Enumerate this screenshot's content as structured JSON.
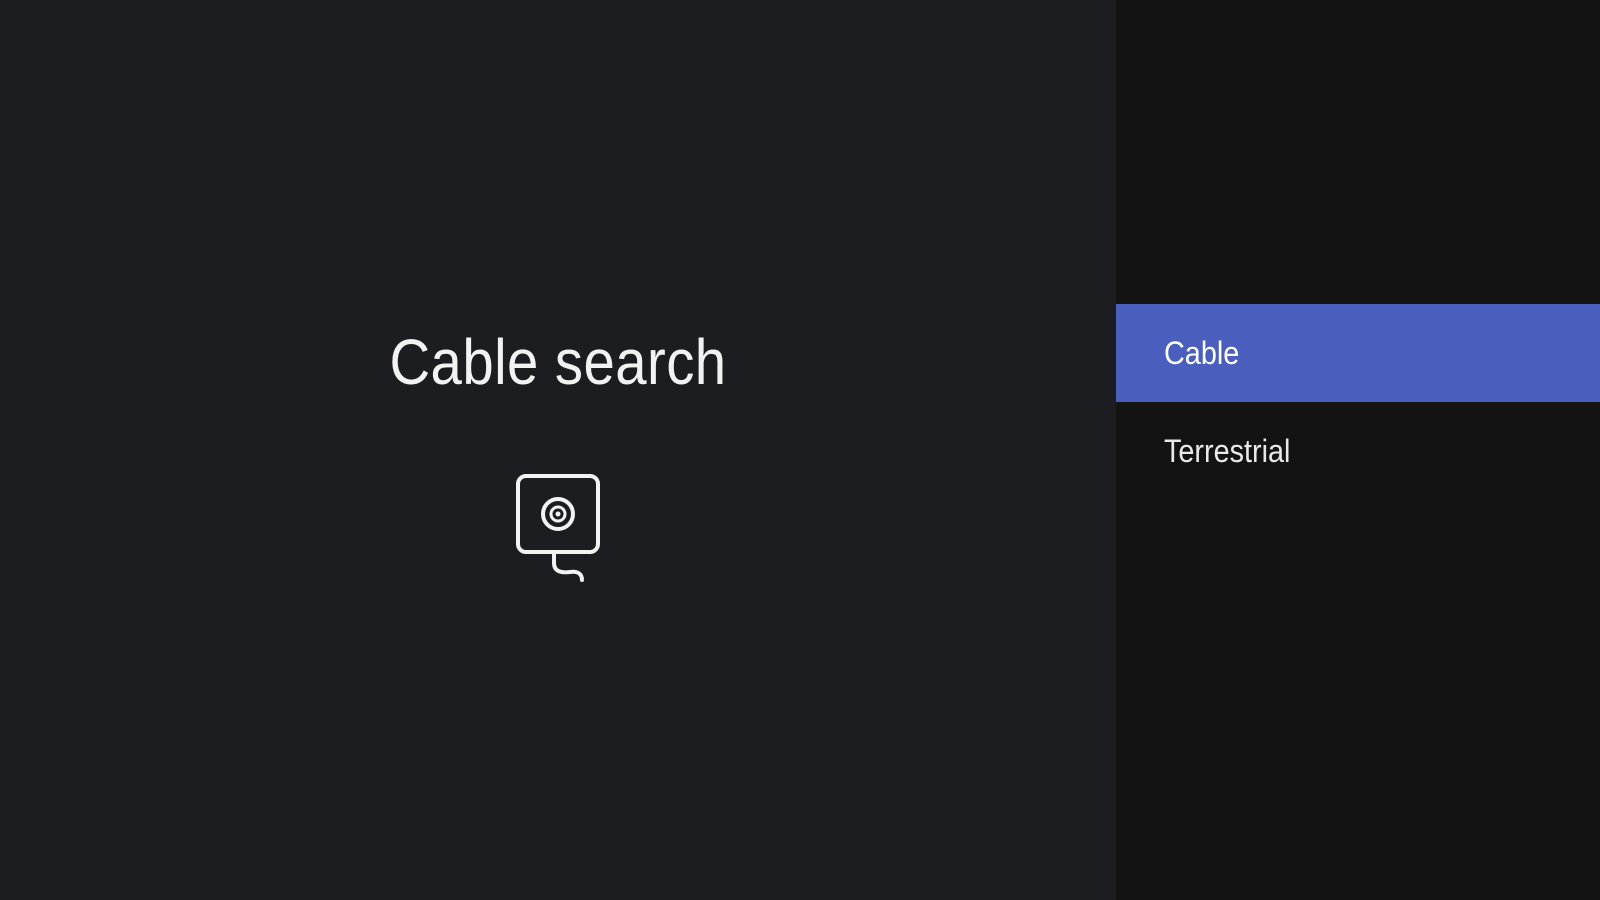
{
  "guidance": {
    "title": "Cable search",
    "icon": "cable-connector-icon"
  },
  "actions": {
    "items": [
      {
        "label": "Cable",
        "selected": true
      },
      {
        "label": "Terrestrial",
        "selected": false
      }
    ]
  },
  "colors": {
    "left_background": "#1c1d21",
    "right_background": "#131314",
    "selection": "#4a5fbd",
    "text": "#f2f2f2"
  }
}
